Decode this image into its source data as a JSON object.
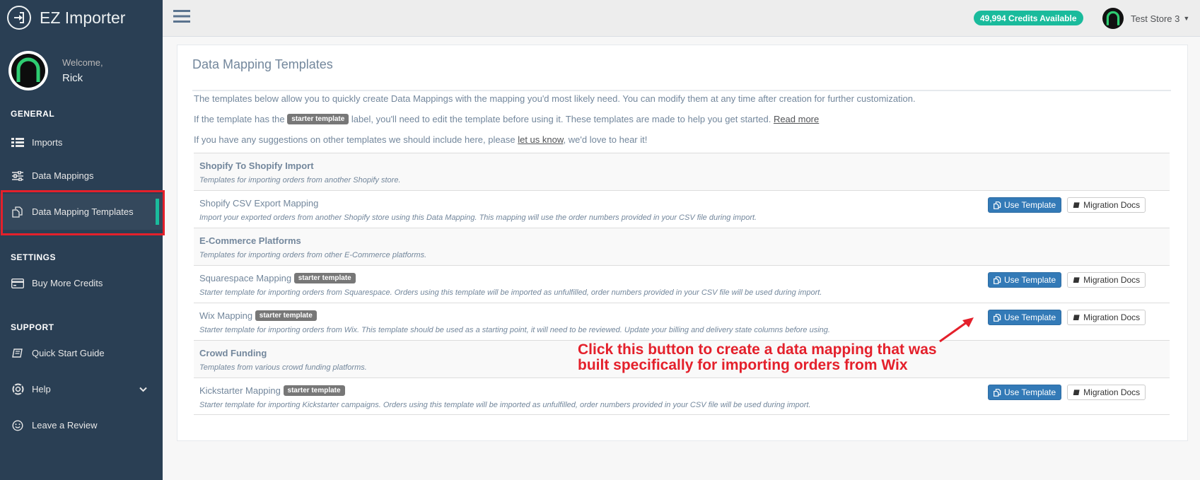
{
  "app": {
    "title": "EZ Importer"
  },
  "profile": {
    "welcome": "Welcome,",
    "name": "Rick"
  },
  "sidebar": {
    "sections": [
      {
        "title": "GENERAL"
      },
      {
        "title": "SETTINGS"
      },
      {
        "title": "SUPPORT"
      }
    ],
    "items": [
      {
        "label": "Imports",
        "icon": "table-list-icon"
      },
      {
        "label": "Data Mappings",
        "icon": "sliders-icon"
      },
      {
        "label": "Data Mapping Templates",
        "icon": "copy-icon",
        "active": true
      },
      {
        "label": "Buy More Credits",
        "icon": "credit-card-icon"
      },
      {
        "label": "Quick Start Guide",
        "icon": "book-icon"
      },
      {
        "label": "Help",
        "icon": "life-ring-icon",
        "has_submenu": true
      },
      {
        "label": "Leave a Review",
        "icon": "smiley-icon"
      }
    ]
  },
  "topbar": {
    "credits": "49,994 Credits Available",
    "store": "Test Store 3"
  },
  "panel": {
    "title": "Data Mapping Templates",
    "intro1": "The templates below allow you to quickly create Data Mappings with the mapping you'd most likely need. You can modify them at any time after creation for further customization.",
    "intro2_before": "If the template has the",
    "intro2_badge": "starter template",
    "intro2_after": "label, you'll need to edit the template before using it. These templates are made to help you get started.",
    "intro2_link": "Read more",
    "intro3_before": "If you have any suggestions on other templates we should include here, please",
    "intro3_link": "let us know",
    "intro3_after": ", we'd love to hear it!"
  },
  "buttons": {
    "use": "Use Template",
    "docs": "Migration Docs"
  },
  "rows": [
    {
      "type": "group",
      "title": "Shopify To Shopify Import",
      "desc": "Templates for importing orders from another Shopify store."
    },
    {
      "type": "template",
      "title": "Shopify CSV Export Mapping",
      "badge": "",
      "desc": "Import your exported orders from another Shopify store using this Data Mapping. This mapping will use the order numbers provided in your CSV file during import."
    },
    {
      "type": "group",
      "title": "E-Commerce Platforms",
      "desc": "Templates for importing orders from other E-Commerce platforms."
    },
    {
      "type": "template",
      "title": "Squarespace Mapping",
      "badge": "starter template",
      "desc": "Starter template for importing orders from Squarespace. Orders using this template will be imported as unfulfilled, order numbers provided in your CSV file will be used during import."
    },
    {
      "type": "template",
      "title": "Wix Mapping",
      "badge": "starter template",
      "desc": "Starter template for importing orders from Wix. This template should be used as a starting point, it will need to be reviewed. Update your billing and delivery state columns before using."
    },
    {
      "type": "group",
      "title": "Crowd Funding",
      "desc": "Templates from various crowd funding platforms."
    },
    {
      "type": "template",
      "title": "Kickstarter Mapping",
      "badge": "starter template",
      "desc": "Starter template for importing Kickstarter campaigns. Orders using this template will be imported as unfulfilled, order numbers provided in your CSV file will be used during import."
    }
  ],
  "annotation": {
    "line1": "Click this button to create a data mapping that was",
    "line2": "built specifically for importing orders from Wix"
  },
  "colors": {
    "sidebar": "#2a3f54",
    "accent": "#1abb9c",
    "primary_button": "#337ab7",
    "annotation": "#e4202b"
  }
}
